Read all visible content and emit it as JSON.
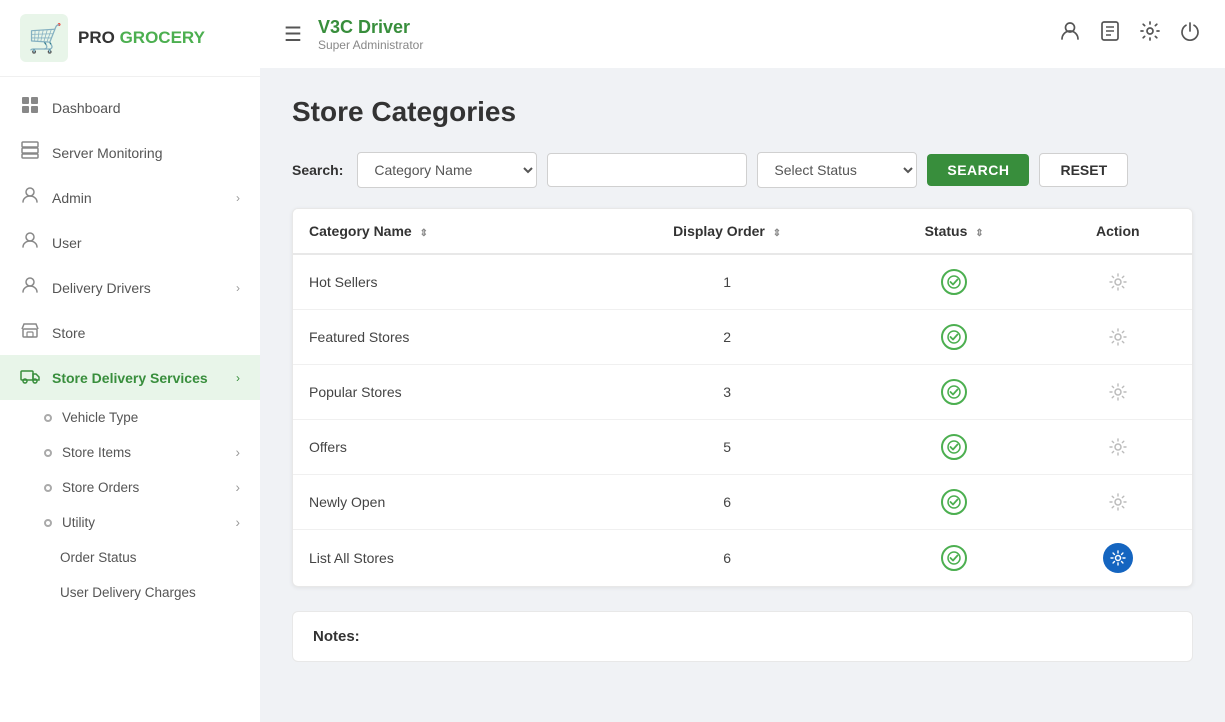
{
  "app": {
    "name": "V3C Driver",
    "sub_title": "Super Administrator",
    "logo_pro": "PRO",
    "logo_grocery": "GROCERY"
  },
  "sidebar": {
    "items": [
      {
        "id": "dashboard",
        "label": "Dashboard",
        "icon": "⊞",
        "has_arrow": false
      },
      {
        "id": "server-monitoring",
        "label": "Server Monitoring",
        "icon": "▦",
        "has_arrow": false
      },
      {
        "id": "admin",
        "label": "Admin",
        "icon": "👤",
        "has_arrow": true
      },
      {
        "id": "user",
        "label": "User",
        "icon": "👤",
        "has_arrow": false
      },
      {
        "id": "delivery-drivers",
        "label": "Delivery Drivers",
        "icon": "👤",
        "has_arrow": true
      },
      {
        "id": "store",
        "label": "Store",
        "icon": "🏪",
        "has_arrow": false
      },
      {
        "id": "store-delivery-services",
        "label": "Store Delivery Services",
        "icon": "🚚",
        "has_arrow": true,
        "active": true
      }
    ],
    "sub_items": [
      {
        "id": "vehicle-type",
        "label": "Vehicle Type"
      },
      {
        "id": "store-items",
        "label": "Store Items",
        "has_arrow": true
      },
      {
        "id": "store-orders",
        "label": "Store Orders",
        "has_arrow": true
      },
      {
        "id": "utility",
        "label": "Utility",
        "has_arrow": true
      },
      {
        "id": "order-status",
        "label": "Order Status"
      },
      {
        "id": "user-delivery-charges",
        "label": "User Delivery Charges"
      }
    ]
  },
  "topbar": {
    "menu_icon": "☰",
    "app_name": "V3C Driver",
    "sub_name": "Super Administrator",
    "icons": [
      "👤",
      "📋",
      "⚙",
      "⏻"
    ]
  },
  "page": {
    "title": "Store Categories"
  },
  "search": {
    "label": "Search:",
    "category_placeholder": "Category Name",
    "text_placeholder": "",
    "status_placeholder": "Select Status",
    "btn_search": "SEARCH",
    "btn_reset": "RESET"
  },
  "table": {
    "columns": [
      {
        "id": "category-name",
        "label": "Category Name",
        "sortable": true
      },
      {
        "id": "display-order",
        "label": "Display Order",
        "sortable": true
      },
      {
        "id": "status",
        "label": "Status",
        "sortable": true
      },
      {
        "id": "action",
        "label": "Action",
        "sortable": false
      }
    ],
    "rows": [
      {
        "id": 1,
        "category_name": "Hot Sellers",
        "display_order": 1,
        "status": "active",
        "action": "gear"
      },
      {
        "id": 2,
        "category_name": "Featured Stores",
        "display_order": 2,
        "status": "active",
        "action": "gear"
      },
      {
        "id": 3,
        "category_name": "Popular Stores",
        "display_order": 3,
        "status": "active",
        "action": "gear"
      },
      {
        "id": 4,
        "category_name": "Offers",
        "display_order": 5,
        "status": "active",
        "action": "gear"
      },
      {
        "id": 5,
        "category_name": "Newly Open",
        "display_order": 6,
        "status": "active",
        "action": "gear"
      },
      {
        "id": 6,
        "category_name": "List All Stores",
        "display_order": 6,
        "status": "active",
        "action": "gear-blue"
      }
    ]
  },
  "notes": {
    "title": "Notes:"
  }
}
